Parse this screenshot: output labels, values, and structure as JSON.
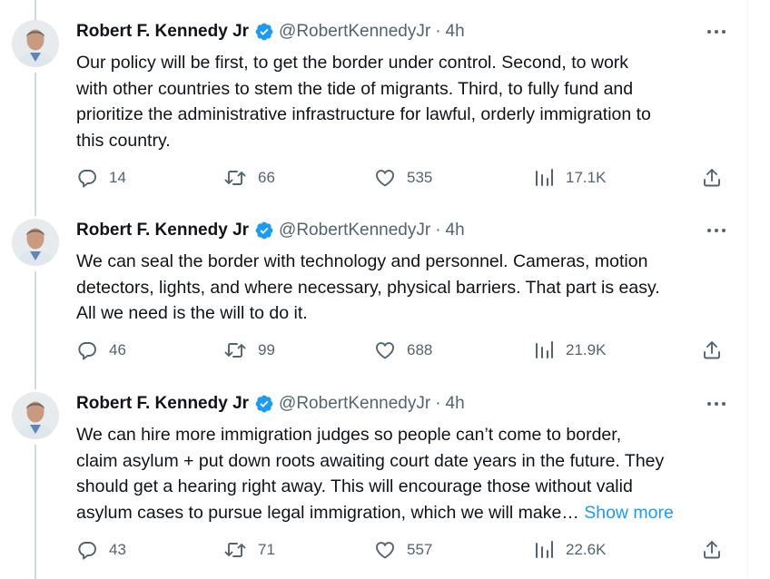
{
  "tweets": [
    {
      "author_name": "Robert F. Kennedy Jr",
      "handle": "@RobertKennedyJr",
      "separator": "·",
      "time": "4h",
      "text_lines": [
        "Our policy will be first, to get the border under control. Second, to work",
        "with other countries to stem the tide of migrants. Third, to fully fund and",
        "prioritize the administrative infrastructure for lawful, orderly immigration to",
        "this country."
      ],
      "replies": "14",
      "retweets": "66",
      "likes": "535",
      "views": "17.1K"
    },
    {
      "author_name": "Robert F. Kennedy Jr",
      "handle": "@RobertKennedyJr",
      "separator": "·",
      "time": "4h",
      "text_lines": [
        "We can seal the border with technology and personnel. Cameras, motion",
        "detectors, lights, and where necessary, physical barriers. That part is easy.",
        "All we need is the will to do it."
      ],
      "replies": "46",
      "retweets": "99",
      "likes": "688",
      "views": "21.9K"
    },
    {
      "author_name": "Robert F. Kennedy Jr",
      "handle": "@RobertKennedyJr",
      "separator": "·",
      "time": "4h",
      "text_lines": [
        "We can hire more immigration judges so people can’t come to border,",
        "claim asylum + put down roots awaiting court date years in the future. They",
        "should get a hearing right away. This will encourage those without valid",
        "asylum cases to pursue legal immigration, which we will make…"
      ],
      "show_more": "Show more",
      "replies": "43",
      "retweets": "71",
      "likes": "557",
      "views": "22.6K"
    }
  ],
  "icons": {
    "verified": "verified-badge-icon",
    "more": "more-horizontal-icon",
    "reply": "reply-bubble-icon",
    "retweet": "retweet-icon",
    "like": "heart-icon",
    "views": "views-bar-chart-icon",
    "share": "share-upload-icon"
  },
  "colors": {
    "verified_blue": "#1d9bf0",
    "link_blue": "#1d9bf0",
    "secondary_text": "#536471",
    "primary_text": "#0f1419",
    "thread_line": "#cfd9de"
  }
}
